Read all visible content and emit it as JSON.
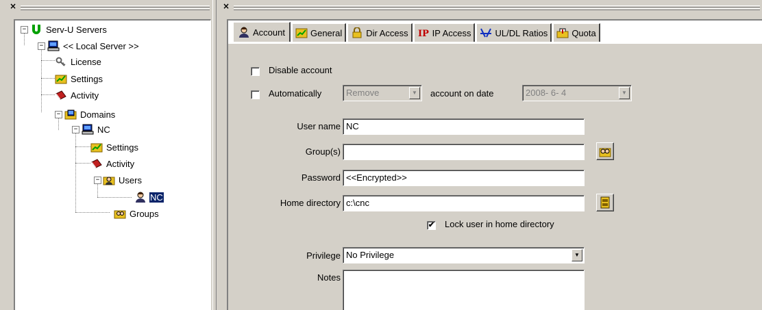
{
  "left_pane": {
    "close_glyph": "×"
  },
  "right_pane": {
    "close_glyph": "×"
  },
  "tree": {
    "root": "Serv-U Servers",
    "server": "<< Local Server >>",
    "license": "License",
    "settings": "Settings",
    "activity": "Activity",
    "domains": "Domains",
    "domain_nc": "NC",
    "domain_settings": "Settings",
    "domain_activity": "Activity",
    "users": "Users",
    "user_nc": "NC",
    "groups": "Groups",
    "expander_open": "−"
  },
  "tabs": [
    {
      "label": "Account",
      "icon": "user-icon"
    },
    {
      "label": "General",
      "icon": "settings-icon"
    },
    {
      "label": "Dir Access",
      "icon": "lock-icon"
    },
    {
      "label": "IP Access",
      "icon": "ip-icon"
    },
    {
      "label": "UL/DL Ratios",
      "icon": "ratio-icon"
    },
    {
      "label": "Quota",
      "icon": "quota-icon"
    }
  ],
  "form": {
    "disable_account": {
      "label": "Disable account",
      "checked": false
    },
    "automatically": {
      "label": "Automatically",
      "checked": false,
      "action_value": "Remove",
      "account_on_date_label": "account on date",
      "date_value": "2008- 6- 4"
    },
    "user_name": {
      "label": "User name",
      "value": "NC"
    },
    "groups": {
      "label": "Group(s)",
      "value": ""
    },
    "password": {
      "label": "Password",
      "value": "<<Encrypted>>"
    },
    "home_directory": {
      "label": "Home directory",
      "value": "c:\\cnc"
    },
    "lock_home": {
      "label": "Lock user in home directory",
      "checked": true,
      "check_glyph": "✔"
    },
    "privilege": {
      "label": "Privilege",
      "value": "No Privilege"
    },
    "notes": {
      "label": "Notes",
      "value": ""
    },
    "dropdown_glyph": "▼"
  },
  "colors": {
    "window_face": "#d4d0c8",
    "selection": "#0a246a",
    "serv_u_green": "#00a000",
    "folder_yellow": "#e8c020"
  }
}
